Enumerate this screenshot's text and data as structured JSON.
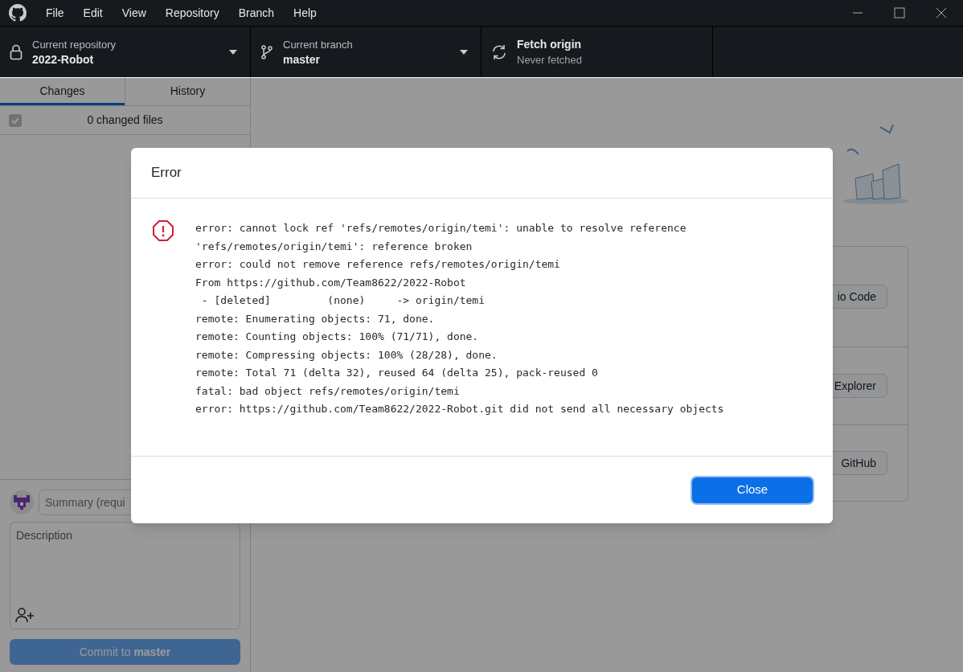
{
  "menu": [
    "File",
    "Edit",
    "View",
    "Repository",
    "Branch",
    "Help"
  ],
  "toolbar": [
    {
      "kind": "repository",
      "label": "Current repository",
      "value": "2022-Robot"
    },
    {
      "kind": "branch",
      "label": "Current branch",
      "value": "master"
    },
    {
      "kind": "fetch",
      "label": "Fetch origin",
      "value": "Never fetched"
    }
  ],
  "tabs": [
    {
      "label": "Changes",
      "selected": true
    },
    {
      "label": "History",
      "selected": false
    }
  ],
  "changes": {
    "checked": true,
    "label": "0 changed files"
  },
  "commit": {
    "summary_placeholder": "Summary (requi",
    "description_placeholder": "Description",
    "button": "Commit to **master**"
  },
  "main": {
    "actions": [
      "io Code",
      "Explorer",
      "GitHub"
    ]
  },
  "dialog": {
    "title": "Error",
    "lines": [
      "error: cannot lock ref 'refs/remotes/origin/temi': unable to resolve reference",
      "'refs/remotes/origin/temi': reference broken",
      "error: could not remove reference refs/remotes/origin/temi",
      "From https://github.com/Team8622/2022-Robot",
      " - [deleted]         (none)     -> origin/temi",
      "remote: Enumerating objects: 71, done.",
      "remote: Counting objects: 100% (71/71), done.",
      "remote: Compressing objects: 100% (28/28), done.",
      "remote: Total 71 (delta 32), reused 64 (delta 25), pack-reused 0",
      "fatal: bad object refs/remotes/origin/temi",
      "error: https://github.com/Team8622/2022-Robot.git did not send all necessary objects"
    ],
    "button": "Close"
  }
}
